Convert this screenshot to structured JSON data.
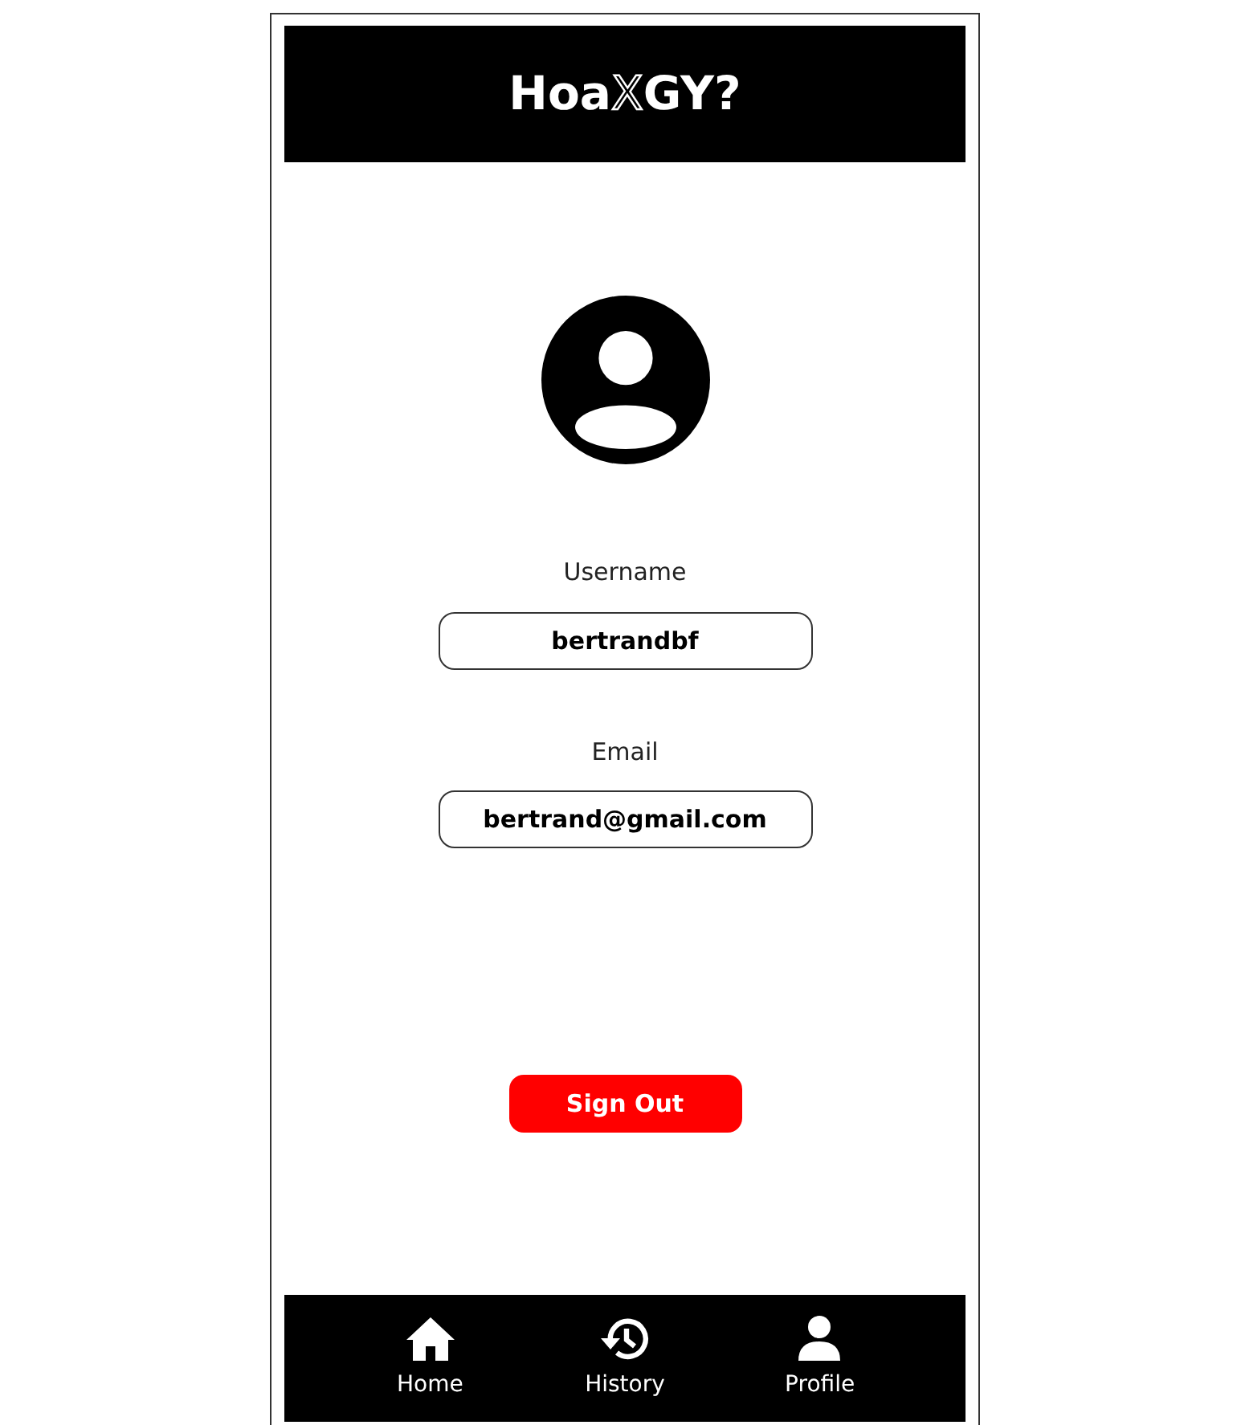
{
  "header": {
    "logo": [
      {
        "kind": "plain",
        "text": "Hoa"
      },
      {
        "kind": "outline",
        "text": "X"
      },
      {
        "kind": "plain",
        "text": "GY?"
      }
    ]
  },
  "fields": [
    {
      "label": "Username",
      "value": "bertrandbf"
    },
    {
      "label": "Email",
      "value": "bertrand@gmail.com"
    }
  ],
  "sign_out": "Sign Out",
  "nav": [
    {
      "kind": "home",
      "label": "Home"
    },
    {
      "kind": "history",
      "label": "History"
    },
    {
      "kind": "profile",
      "label": "Profile"
    }
  ]
}
